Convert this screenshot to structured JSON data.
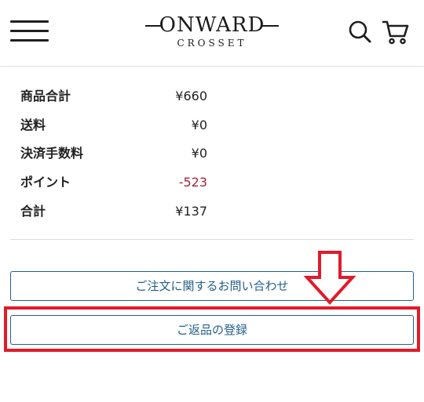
{
  "header": {
    "logo_main": "ONWARD",
    "logo_sub": "CROSSET",
    "icons": [
      "menu-icon",
      "search-icon",
      "cart-icon"
    ]
  },
  "summary": {
    "rows": [
      {
        "label": "商品合計",
        "value": "¥660"
      },
      {
        "label": "送料",
        "value": "¥0"
      },
      {
        "label": "決済手数料",
        "value": "¥0"
      },
      {
        "label": "ポイント",
        "value": "-523"
      },
      {
        "label": "合計",
        "value": "¥137"
      }
    ]
  },
  "actions": {
    "contact_label": "ご注文に関するお問い合わせ",
    "return_label": "ご返品の登録"
  },
  "colors": {
    "accent": "#24608a",
    "negative": "#a3253c",
    "annotation": "#e01b2a"
  }
}
